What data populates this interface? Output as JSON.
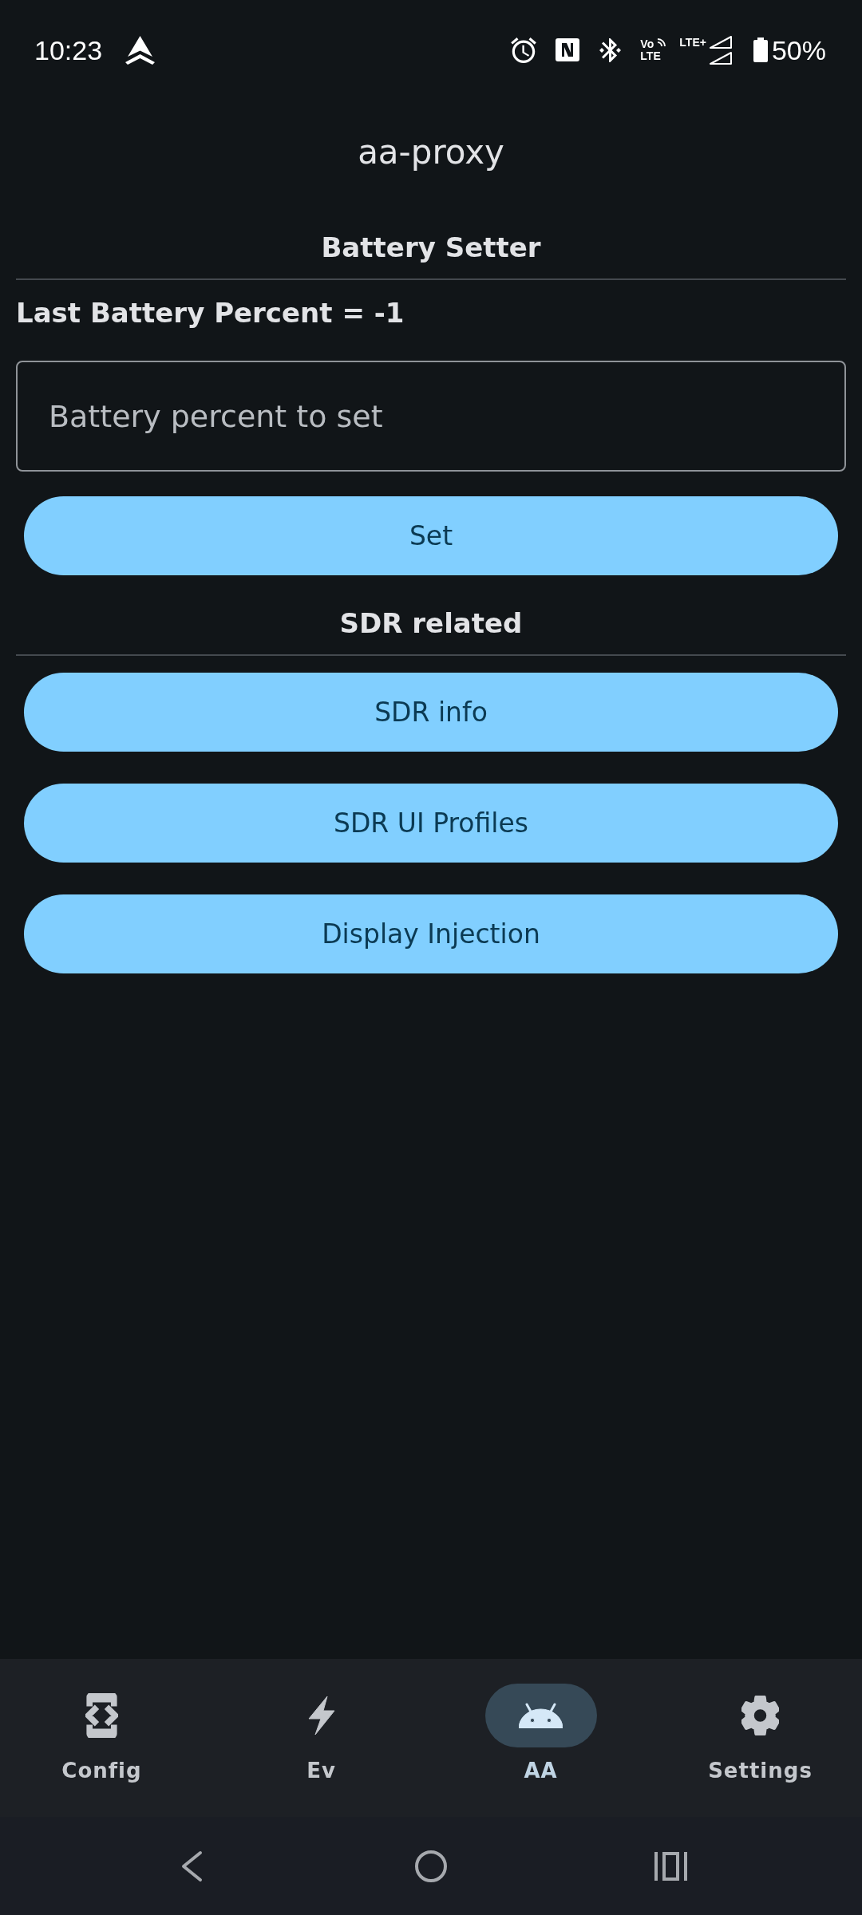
{
  "status_bar": {
    "time": "10:23",
    "volte_top": "Vo",
    "volte_bottom": "LTE",
    "network_type": "LTE+",
    "battery": "50%"
  },
  "app_bar": {
    "title": "aa-proxy"
  },
  "sections": [
    {
      "title": "Battery Setter",
      "items": [
        {
          "kind": "text",
          "text": "Last Battery Percent = -1"
        },
        {
          "kind": "field",
          "placeholder": "Battery percent to set"
        },
        {
          "kind": "button",
          "label": "Set"
        }
      ]
    },
    {
      "title": "SDR related",
      "items": [
        {
          "kind": "button",
          "label": "SDR info"
        },
        {
          "kind": "button",
          "label": "SDR UI Profiles"
        },
        {
          "kind": "button",
          "label": "Display Injection"
        }
      ]
    }
  ],
  "bottom_nav": [
    {
      "label": "Config",
      "selected": false
    },
    {
      "label": "Ev",
      "selected": false
    },
    {
      "label": "AA",
      "selected": true
    },
    {
      "label": "Settings",
      "selected": false
    }
  ]
}
